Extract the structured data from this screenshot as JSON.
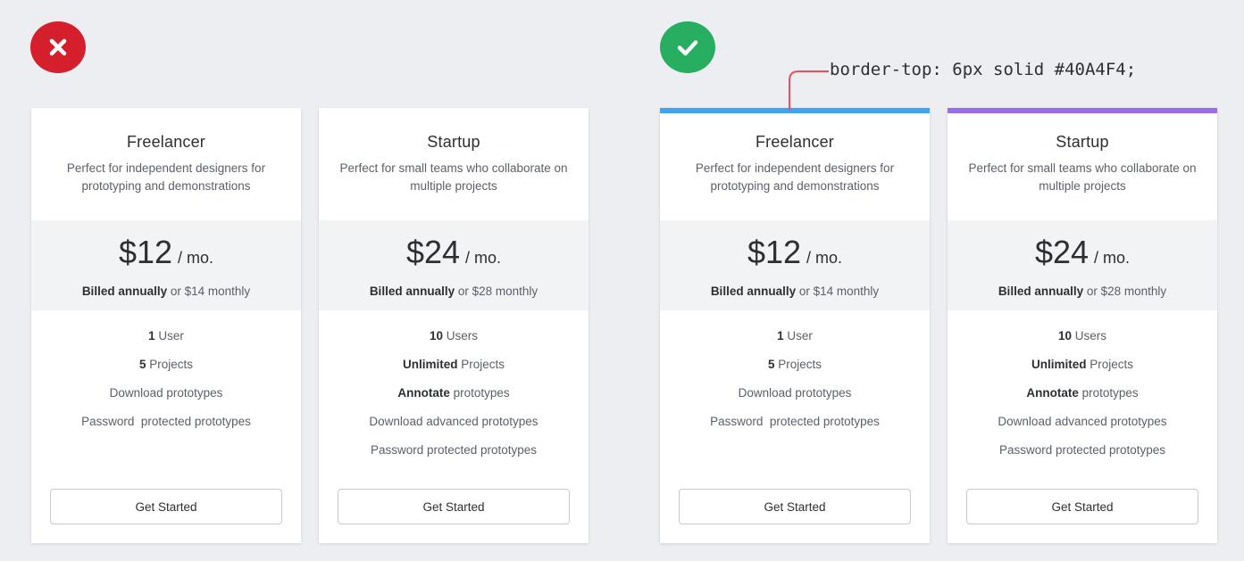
{
  "comparison": {
    "bad": {
      "status_icon": "x-icon",
      "status_color": "#d61f2c",
      "cards": [
        {
          "title": "Freelancer",
          "description": "Perfect for independent designers for prototyping and demonstrations",
          "price": "$12",
          "period": "/ mo.",
          "billing_bold": "Billed annually",
          "billing_rest": "or $14 monthly",
          "features": [
            {
              "bold": "1",
              "text": "User"
            },
            {
              "bold": "5",
              "text": "Projects"
            },
            {
              "bold": "",
              "text": "Download prototypes"
            },
            {
              "bold": "",
              "text": "Password  protected prototypes"
            }
          ],
          "cta": "Get Started"
        },
        {
          "title": "Startup",
          "description": "Perfect for small teams who collaborate on multiple projects",
          "price": "$24",
          "period": "/ mo.",
          "billing_bold": "Billed annually",
          "billing_rest": "or $28 monthly",
          "features": [
            {
              "bold": "10",
              "text": "Users"
            },
            {
              "bold": "Unlimited",
              "text": "Projects"
            },
            {
              "bold": "Annotate",
              "text": "prototypes"
            },
            {
              "bold": "",
              "text": "Download advanced prototypes"
            },
            {
              "bold": "",
              "text": "Password protected prototypes"
            }
          ],
          "cta": "Get Started"
        }
      ]
    },
    "good": {
      "status_icon": "check-icon",
      "status_color": "#27ae60",
      "annotation": "border-top: 6px solid #40A4F4;",
      "cards": [
        {
          "accent_color": "#40A4F4",
          "title": "Freelancer",
          "description": "Perfect for independent designers for prototyping and demonstrations",
          "price": "$12",
          "period": "/ mo.",
          "billing_bold": "Billed annually",
          "billing_rest": "or $14 monthly",
          "features": [
            {
              "bold": "1",
              "text": "User"
            },
            {
              "bold": "5",
              "text": "Projects"
            },
            {
              "bold": "",
              "text": "Download prototypes"
            },
            {
              "bold": "",
              "text": "Password  protected prototypes"
            }
          ],
          "cta": "Get Started"
        },
        {
          "accent_color": "#9b6cf0",
          "title": "Startup",
          "description": "Perfect for small teams who collaborate on multiple projects",
          "price": "$24",
          "period": "/ mo.",
          "billing_bold": "Billed annually",
          "billing_rest": "or $28 monthly",
          "features": [
            {
              "bold": "10",
              "text": "Users"
            },
            {
              "bold": "Unlimited",
              "text": "Projects"
            },
            {
              "bold": "Annotate",
              "text": "prototypes"
            },
            {
              "bold": "",
              "text": "Download advanced prototypes"
            },
            {
              "bold": "",
              "text": "Password protected prototypes"
            }
          ],
          "cta": "Get Started"
        }
      ]
    }
  }
}
